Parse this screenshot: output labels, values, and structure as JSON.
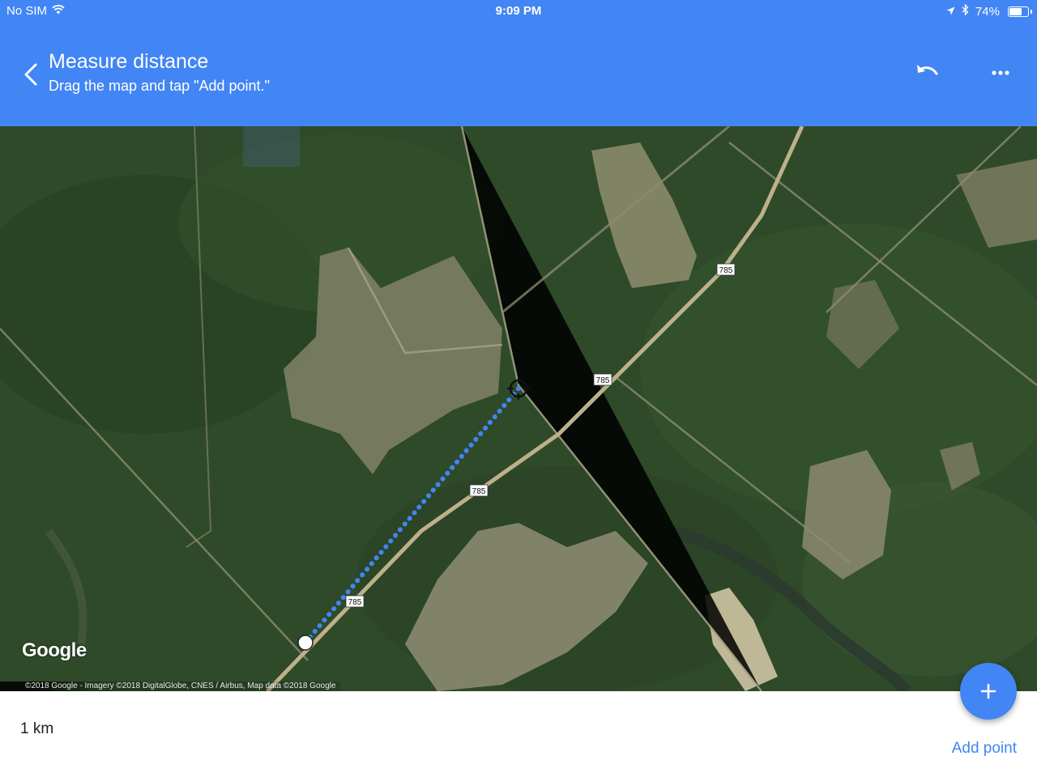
{
  "status_bar": {
    "carrier": "No SIM",
    "time": "9:09 PM",
    "battery": "74%",
    "battery_level": 0.74,
    "icons": [
      "wifi-icon",
      "location-arrow-icon",
      "bluetooth-icon",
      "battery-icon"
    ]
  },
  "header": {
    "title": "Measure distance",
    "subtitle": "Drag the map and tap \"Add point.\"",
    "icons": [
      "back-arrow-icon",
      "undo-icon",
      "more-icon"
    ]
  },
  "map": {
    "route_labels": [
      "785",
      "785",
      "785",
      "785"
    ],
    "logo": "Google",
    "attribution": "©2018 Google - Imagery ©2018 DigitalGlobe, CNES / Airbus, Map data ©2018 Google"
  },
  "bottom": {
    "distance": "1 km",
    "add_point_label": "Add point"
  },
  "colors": {
    "accent": "#4285f4",
    "header_bg": "#4285f4",
    "measure_line": "#4285f4"
  }
}
